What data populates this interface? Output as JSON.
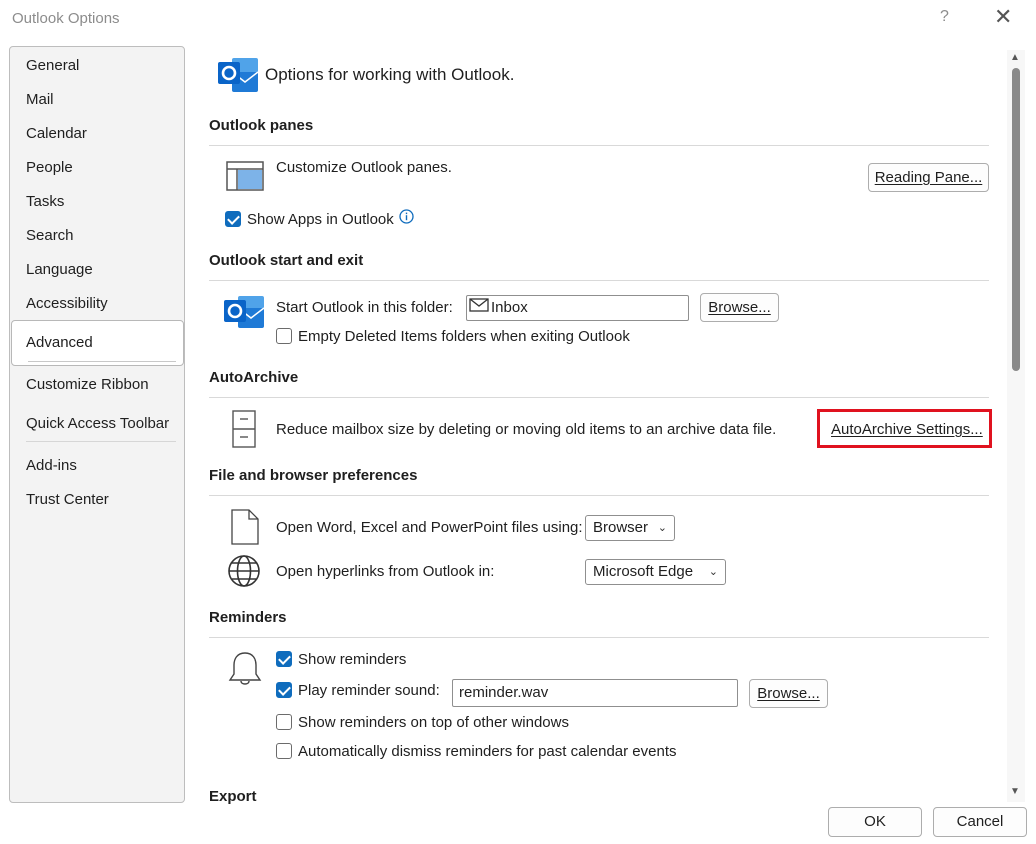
{
  "window": {
    "title": "Outlook Options",
    "help": "?",
    "close": "✕"
  },
  "sidebar": {
    "items": [
      {
        "label": "General"
      },
      {
        "label": "Mail"
      },
      {
        "label": "Calendar"
      },
      {
        "label": "People"
      },
      {
        "label": "Tasks"
      },
      {
        "label": "Search"
      },
      {
        "label": "Language"
      },
      {
        "label": "Accessibility"
      },
      {
        "label": "Advanced",
        "selected": true
      },
      {
        "label": "Customize Ribbon"
      },
      {
        "label": "Quick Access Toolbar"
      },
      {
        "label": "Add-ins"
      },
      {
        "label": "Trust Center"
      }
    ]
  },
  "header": {
    "title": "Options for working with Outlook."
  },
  "sections": {
    "panes": {
      "title": "Outlook panes",
      "customize_label": "Customize Outlook panes.",
      "reading_pane_button": "Reading Pane...",
      "show_apps_label": "Show Apps in Outlook",
      "show_apps_checked": true
    },
    "start_exit": {
      "title": "Outlook start and exit",
      "start_folder_label": "Start Outlook in this folder:",
      "start_folder_value": "Inbox",
      "browse_button": "Browse...",
      "empty_deleted_label": "Empty Deleted Items folders when exiting Outlook",
      "empty_deleted_checked": false
    },
    "autoarchive": {
      "title": "AutoArchive",
      "description": "Reduce mailbox size by deleting or moving old items to an archive data file.",
      "settings_button": "AutoArchive Settings..."
    },
    "file_browser": {
      "title": "File and browser preferences",
      "open_files_label": "Open Word, Excel and PowerPoint files using:",
      "open_files_value": "Browser",
      "hyperlinks_label": "Open hyperlinks from Outlook in:",
      "hyperlinks_value": "Microsoft Edge"
    },
    "reminders": {
      "title": "Reminders",
      "show_reminders_label": "Show reminders",
      "show_reminders_checked": true,
      "play_sound_label": "Play reminder sound:",
      "play_sound_checked": true,
      "sound_file": "reminder.wav",
      "browse_button": "Browse...",
      "on_top_label": "Show reminders on top of other windows",
      "on_top_checked": false,
      "auto_dismiss_label": "Automatically dismiss reminders for past calendar events",
      "auto_dismiss_checked": false
    },
    "export": {
      "title": "Export"
    }
  },
  "footer": {
    "ok": "OK",
    "cancel": "Cancel"
  },
  "colors": {
    "accent": "#0f6cbd",
    "highlight": "#e0121f",
    "outlook_blue": "#0a64c8"
  }
}
